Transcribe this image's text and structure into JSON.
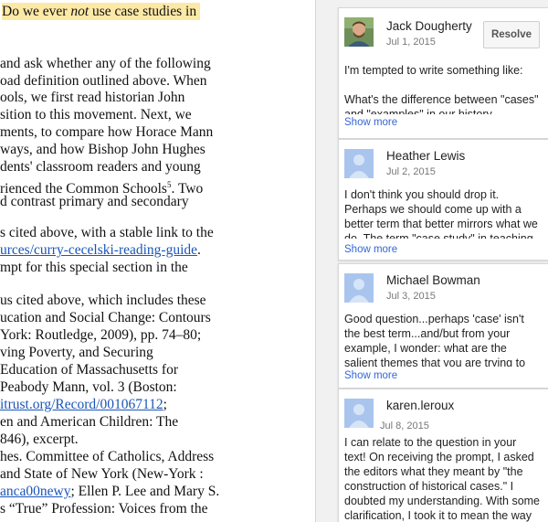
{
  "document": {
    "lines": [
      {
        "text": ""
      },
      {
        "text": ""
      },
      {
        "text": ""
      },
      {
        "text": " and ask whether any of the following"
      },
      {
        "text": "oad definition outlined above. When"
      },
      {
        "text": "ools, we first read historian John"
      },
      {
        "text": "sition to this movement. Next, we"
      },
      {
        "text": "ments, to compare how Horace Mann"
      },
      {
        "text": "ways, and how Bishop John Hughes"
      },
      {
        "text": "dents' classroom readers and young"
      },
      {
        "text": "rienced the Common Schools"
      },
      {
        "text": "d contrast primary and secondary"
      },
      {
        "text": "s cited above, with a stable link to the"
      },
      {
        "text": "urces/curry-cecelski-reading-guide"
      },
      {
        "text": "mpt for this special section in the"
      },
      {
        "text": "us cited above, which includes these"
      },
      {
        "text": "ucation and Social Change: Contours"
      },
      {
        "text": "York: Routledge, 2009), pp. 74–80;"
      },
      {
        "text": "ving Poverty, and Securing"
      },
      {
        "text": "Education of Massachusetts for"
      },
      {
        "text": "Peabody Mann, vol. 3 (Boston:"
      },
      {
        "text": "itrust.org/Record/001067112"
      },
      {
        "text": "en and American Children: The"
      },
      {
        "text": "846), excerpt."
      },
      {
        "text": "hes. Committee of Catholics, Address"
      },
      {
        "text": " and State of New York (New-York :"
      },
      {
        "text": "anca00newy"
      },
      {
        "text": "s “True” Profession: Voices from the"
      }
    ],
    "highlight_prefix": "Do we ever ",
    "highlight_em": "not",
    "highlight_suffix": " use case studies in",
    "footnote_mark": "5",
    "two_suffix": ". Two",
    "link_period": ".",
    "semicolon": ";",
    "lee_suffix": "; Ellen P. Lee and Mary S."
  },
  "comments": [
    {
      "author": "Jack Dougherty",
      "date": "Jul 1, 2015",
      "resolve_label": "Resolve",
      "lines": [
        "I'm tempted to write something like:",
        "",
        "What's the difference between \"cases\"",
        "and \"examples\" in our history"
      ],
      "show_more": "Show more",
      "avatar": "photo-avatar"
    },
    {
      "author": "Heather Lewis",
      "date": "Jul 2, 2015",
      "lines": [
        "I don't think you should drop it.",
        "Perhaps we should come up with a",
        "better term that better mirrors what we",
        "do. The term \"case study\" in teaching"
      ],
      "show_more": "Show more",
      "avatar": "default-avatar"
    },
    {
      "author": "Michael Bowman",
      "date": "Jul 3, 2015",
      "lines": [
        "Good question...perhaps 'case' isn't",
        "the best term...and/but from your",
        "example, I wonder: what are the",
        "salient themes that you are trying to"
      ],
      "show_more": "Show more",
      "avatar": "default-avatar"
    },
    {
      "author": "karen.leroux",
      "date": "Jul 8, 2015",
      "lines": [
        "I can relate to the question in your",
        "text! On receiving the prompt, I asked",
        "the editors what they meant by \"the",
        "construction of historical cases.\" I",
        "doubted my understanding. With some",
        "clarification, I took it to mean the way"
      ],
      "show_more": "",
      "avatar": "default-avatar"
    }
  ]
}
